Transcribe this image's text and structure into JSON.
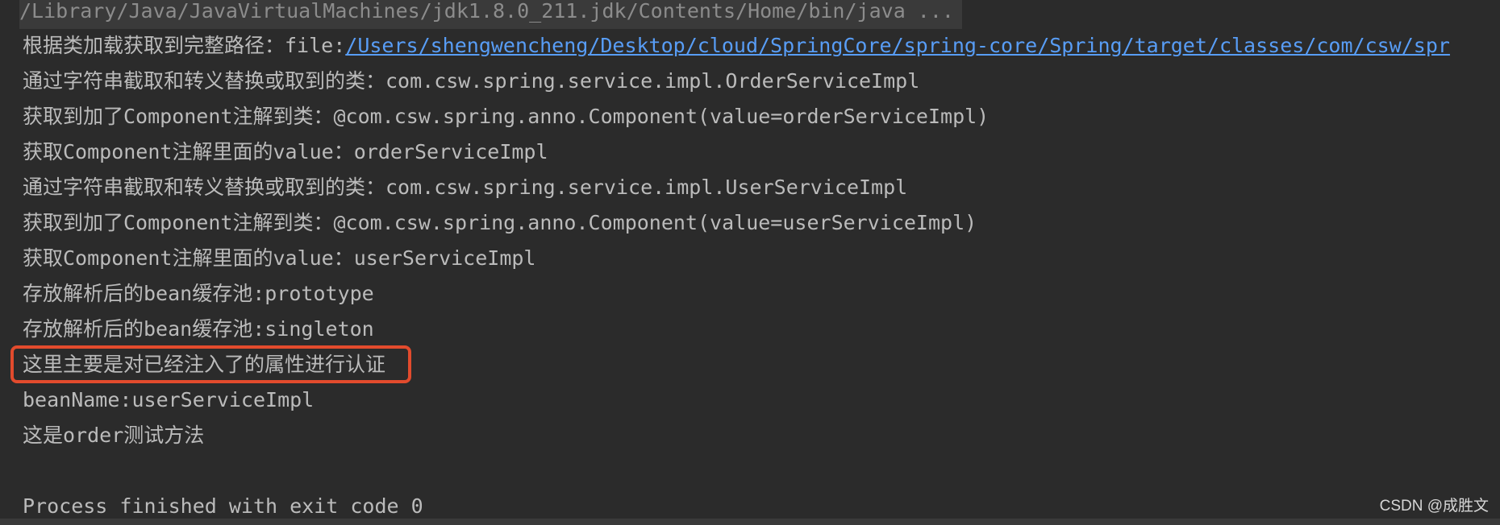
{
  "console": {
    "command": "/Library/Java/JavaVirtualMachines/jdk1.8.0_211.jdk/Contents/Home/bin/java ...",
    "lines": [
      {
        "prefix": "根据类加载获取到完整路径：file:",
        "link": "/Users/shengwencheng/Desktop/cloud/SpringCore/spring-core/Spring/target/classes/com/csw/spr"
      },
      {
        "text": "通过字符串截取和转义替换或取到的类：com.csw.spring.service.impl.OrderServiceImpl"
      },
      {
        "text": "获取到加了Component注解到类：@com.csw.spring.anno.Component(value=orderServiceImpl)"
      },
      {
        "text": "获取Component注解里面的value：orderServiceImpl"
      },
      {
        "text": "通过字符串截取和转义替换或取到的类：com.csw.spring.service.impl.UserServiceImpl"
      },
      {
        "text": "获取到加了Component注解到类：@com.csw.spring.anno.Component(value=userServiceImpl)"
      },
      {
        "text": "获取Component注解里面的value：userServiceImpl"
      },
      {
        "text": "存放解析后的bean缓存池:prototype"
      },
      {
        "text": "存放解析后的bean缓存池:singleton"
      },
      {
        "text": "这里主要是对已经注入了的属性进行认证"
      },
      {
        "text": "beanName:userServiceImpl"
      },
      {
        "text": "这是order测试方法"
      },
      {
        "text": ""
      },
      {
        "text": "Process finished with exit code 0"
      }
    ]
  },
  "watermark": "CSDN @成胜文",
  "colors": {
    "background": "#2b2b2b",
    "text": "#bbbbbb",
    "link": "#589df6",
    "highlight": "#e24b2d"
  }
}
